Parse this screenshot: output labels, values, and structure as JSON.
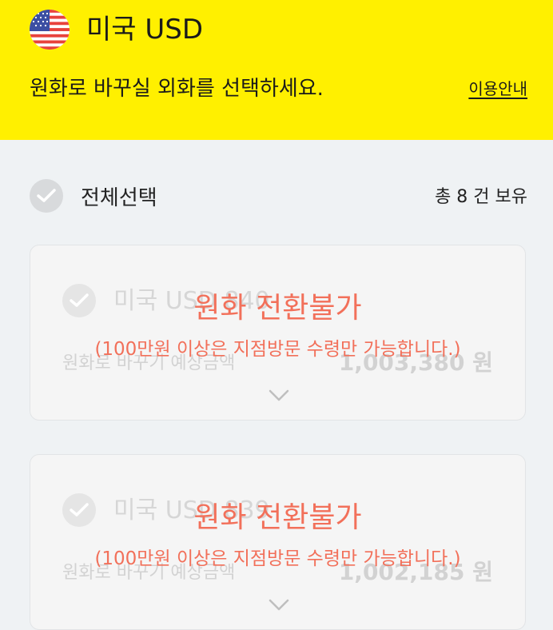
{
  "header": {
    "currency_title": "미국 USD",
    "instruction": "원화로 바꾸실 외화를 선택하세요.",
    "guide_link": "이용안내",
    "flag_icon": "us-flag-icon"
  },
  "selection": {
    "select_all_label": "전체선택",
    "holding_count": "총 8 건 보유"
  },
  "cards": [
    {
      "name": "미국 USD 840",
      "label": "원화로 바꾸기 예상금액",
      "amount": "1,003,380 원",
      "overlay_title": "원화 전환불가",
      "overlay_note": "(100만원 이상은 지점방문 수령만 가능합니다.)"
    },
    {
      "name": "미국 USD 839",
      "label": "원화로 바꾸기 예상금액",
      "amount": "1,002,185 원",
      "overlay_title": "원화 전환불가",
      "overlay_note": "(100만원 이상은 지점방문 수령만 가능합니다.)"
    }
  ],
  "colors": {
    "header_bg": "#fff000",
    "page_bg": "#eff2f4",
    "warning_text": "#f2705a",
    "disabled_text": "#d2d2d2"
  }
}
